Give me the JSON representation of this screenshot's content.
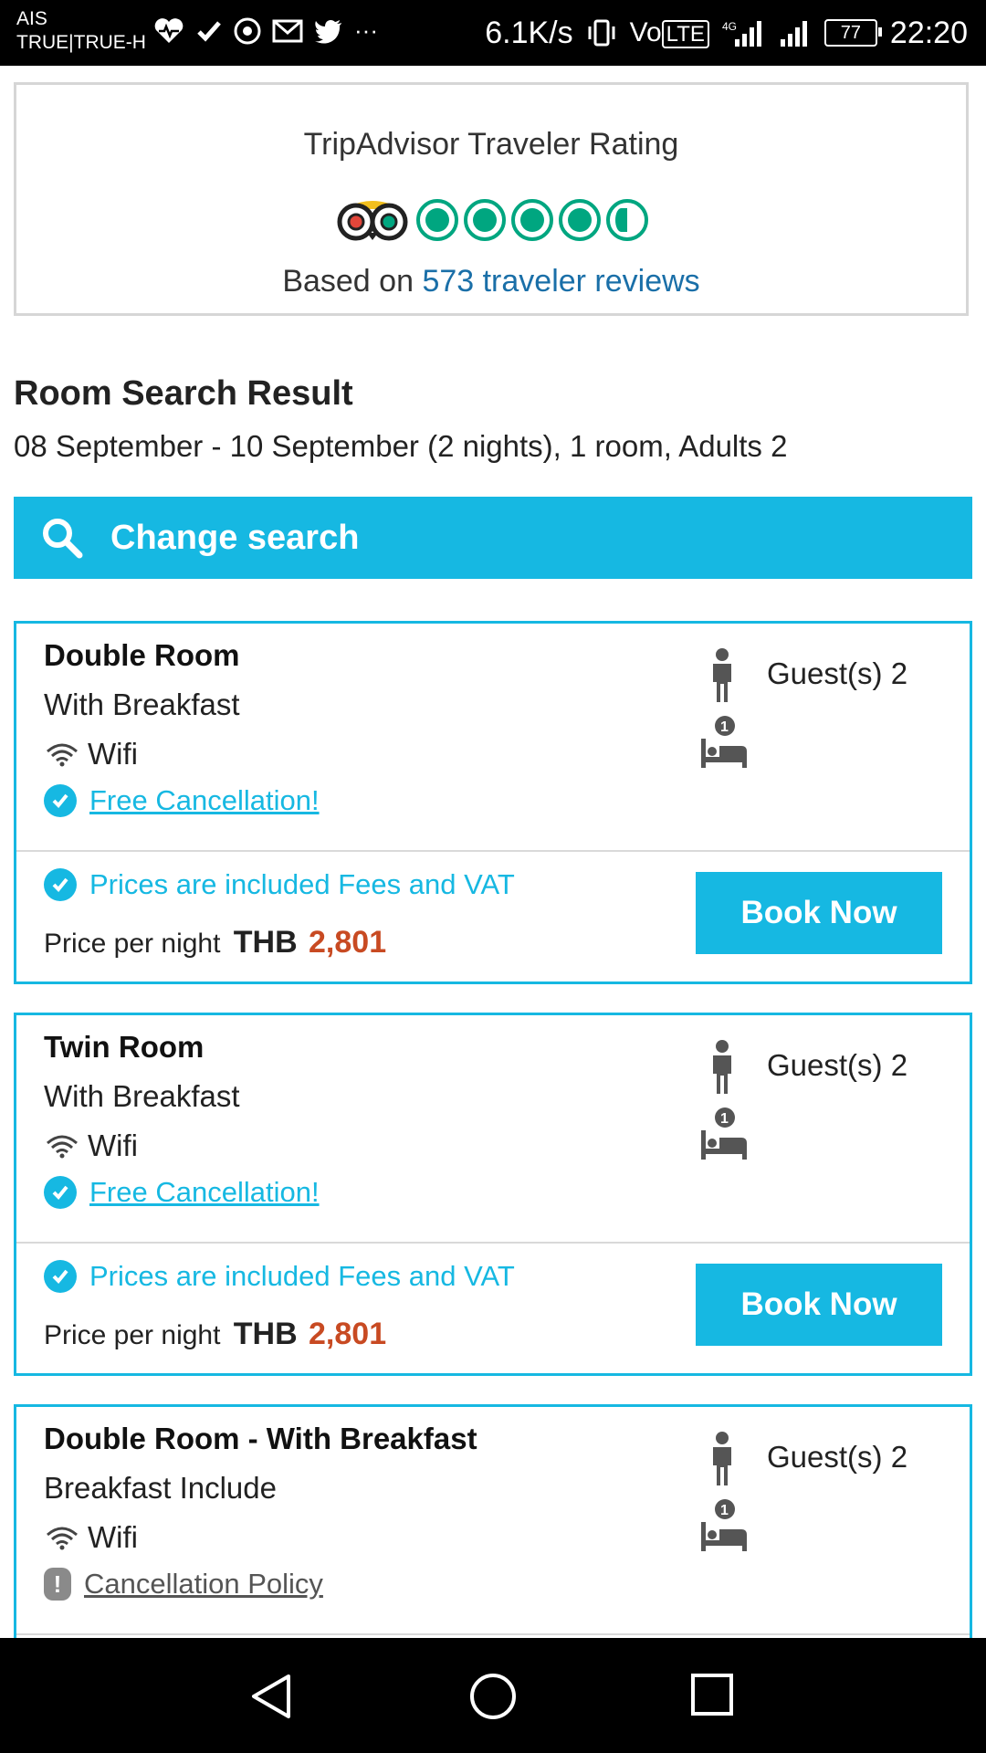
{
  "status_bar": {
    "carrier_line1": "AIS",
    "carrier_line2": "TRUE|TRUE-H",
    "network_speed": "6.1K/s",
    "volte": "Vo",
    "lte": "LTE",
    "battery": "77",
    "time": "22:20"
  },
  "rating": {
    "title": "TripAdvisor Traveler Rating",
    "score": 4.5,
    "based_on": "Based on",
    "reviews_link": "573 traveler reviews"
  },
  "search_result": {
    "title": "Room Search Result",
    "summary": "08 September - 10 September (2 nights), 1 room, Adults 2",
    "change_search_label": "Change search"
  },
  "rooms": [
    {
      "name": "Double Room",
      "meal": "With Breakfast",
      "wifi": "Wifi",
      "cancellation": "Free Cancellation!",
      "guests": "Guest(s) 2",
      "bed_count": "1",
      "price_note": "Prices are included Fees and VAT",
      "price_label": "Price per night",
      "currency": "THB",
      "price": "2,801",
      "book_label": "Book Now"
    },
    {
      "name": "Twin Room",
      "meal": "With Breakfast",
      "wifi": "Wifi",
      "cancellation": "Free Cancellation!",
      "guests": "Guest(s) 2",
      "bed_count": "1",
      "price_note": "Prices are included Fees and VAT",
      "price_label": "Price per night",
      "currency": "THB",
      "price": "2,801",
      "book_label": "Book Now"
    },
    {
      "name": "Double Room - With Breakfast",
      "meal": "Breakfast Include",
      "wifi": "Wifi",
      "cancellation": "Cancellation Policy",
      "guests": "Guest(s) 2",
      "bed_count": "1"
    }
  ],
  "colors": {
    "accent": "#16b8e2",
    "price": "#c84a22",
    "tripadvisor_green": "#00a680",
    "link": "#1a6fa8"
  },
  "icons": {
    "search": "search-icon",
    "wifi": "wifi-icon",
    "check": "check-circle-icon",
    "warning": "exclamation-icon",
    "guest": "person-icon",
    "bed": "bed-icon"
  }
}
